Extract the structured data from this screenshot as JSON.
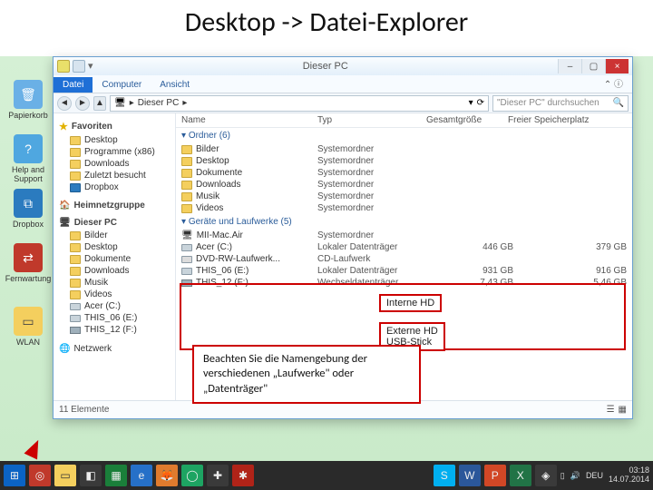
{
  "slide": {
    "title": "Desktop -> Datei-Explorer"
  },
  "desktop_icons": [
    {
      "label": "Papierkorb"
    },
    {
      "label": "Help and Support"
    },
    {
      "label": "Dropbox"
    },
    {
      "label": "Fernwartung"
    },
    {
      "label": "WLAN"
    }
  ],
  "explorer": {
    "titlebar": {
      "title": "Dieser PC",
      "min": "–",
      "max": "▢",
      "close": "×"
    },
    "tabs": {
      "file": "Datei",
      "computer": "Computer",
      "view": "Ansicht"
    },
    "addressbar": {
      "location": "Dieser PC",
      "refresh": "⟳"
    },
    "search": {
      "placeholder": "\"Dieser PC\" durchsuchen"
    },
    "nav": {
      "fav_header": "Favoriten",
      "favorites": [
        {
          "label": "Desktop"
        },
        {
          "label": "Programme (x86)"
        },
        {
          "label": "Downloads"
        },
        {
          "label": "Zuletzt besucht"
        },
        {
          "label": "Dropbox"
        }
      ],
      "homegroup": "Heimnetzgruppe",
      "thispc_header": "Dieser PC",
      "thispc": [
        {
          "label": "Bilder"
        },
        {
          "label": "Desktop"
        },
        {
          "label": "Dokumente"
        },
        {
          "label": "Downloads"
        },
        {
          "label": "Musik"
        },
        {
          "label": "Videos"
        },
        {
          "label": "Acer (C:)"
        },
        {
          "label": "THIS_06 (E:)"
        },
        {
          "label": "THIS_12 (F:)"
        }
      ],
      "network": "Netzwerk"
    },
    "columns": {
      "name": "Name",
      "type": "Typ",
      "size": "Gesamtgröße",
      "free": "Freier Speicherplatz"
    },
    "sections": {
      "folders_header": "Ordner (6)",
      "folders": [
        {
          "name": "Bilder",
          "type": "Systemordner"
        },
        {
          "name": "Desktop",
          "type": "Systemordner"
        },
        {
          "name": "Dokumente",
          "type": "Systemordner"
        },
        {
          "name": "Downloads",
          "type": "Systemordner"
        },
        {
          "name": "Musik",
          "type": "Systemordner"
        },
        {
          "name": "Videos",
          "type": "Systemordner"
        }
      ],
      "drives_header": "Geräte und Laufwerke (5)",
      "drives": [
        {
          "name": "MII-Mac.Air",
          "type": "Systemordner",
          "size": "",
          "free": ""
        },
        {
          "name": "Acer (C:)",
          "type": "Lokaler Datenträger",
          "size": "446 GB",
          "free": "379 GB"
        },
        {
          "name": "DVD-RW-Laufwerk...",
          "type": "CD-Laufwerk",
          "size": "",
          "free": ""
        },
        {
          "name": "THIS_06 (E:)",
          "type": "Lokaler Datenträger",
          "size": "931 GB",
          "free": "916 GB"
        },
        {
          "name": "THIS_12 (F:)",
          "type": "Wechseldatenträger",
          "size": "7,43 GB",
          "free": "5,46 GB"
        }
      ]
    },
    "status": "11 Elemente"
  },
  "annotations": {
    "internal": "Interne HD",
    "external_l1": "Externe HD",
    "external_l2": "USB-Stick",
    "note": "Beachten Sie die Namengebung der verschiedenen „Laufwerke\" oder „Datenträger\""
  },
  "taskbar": {
    "lang": "DEU",
    "time": "03:18",
    "date": "14.07.2014"
  }
}
